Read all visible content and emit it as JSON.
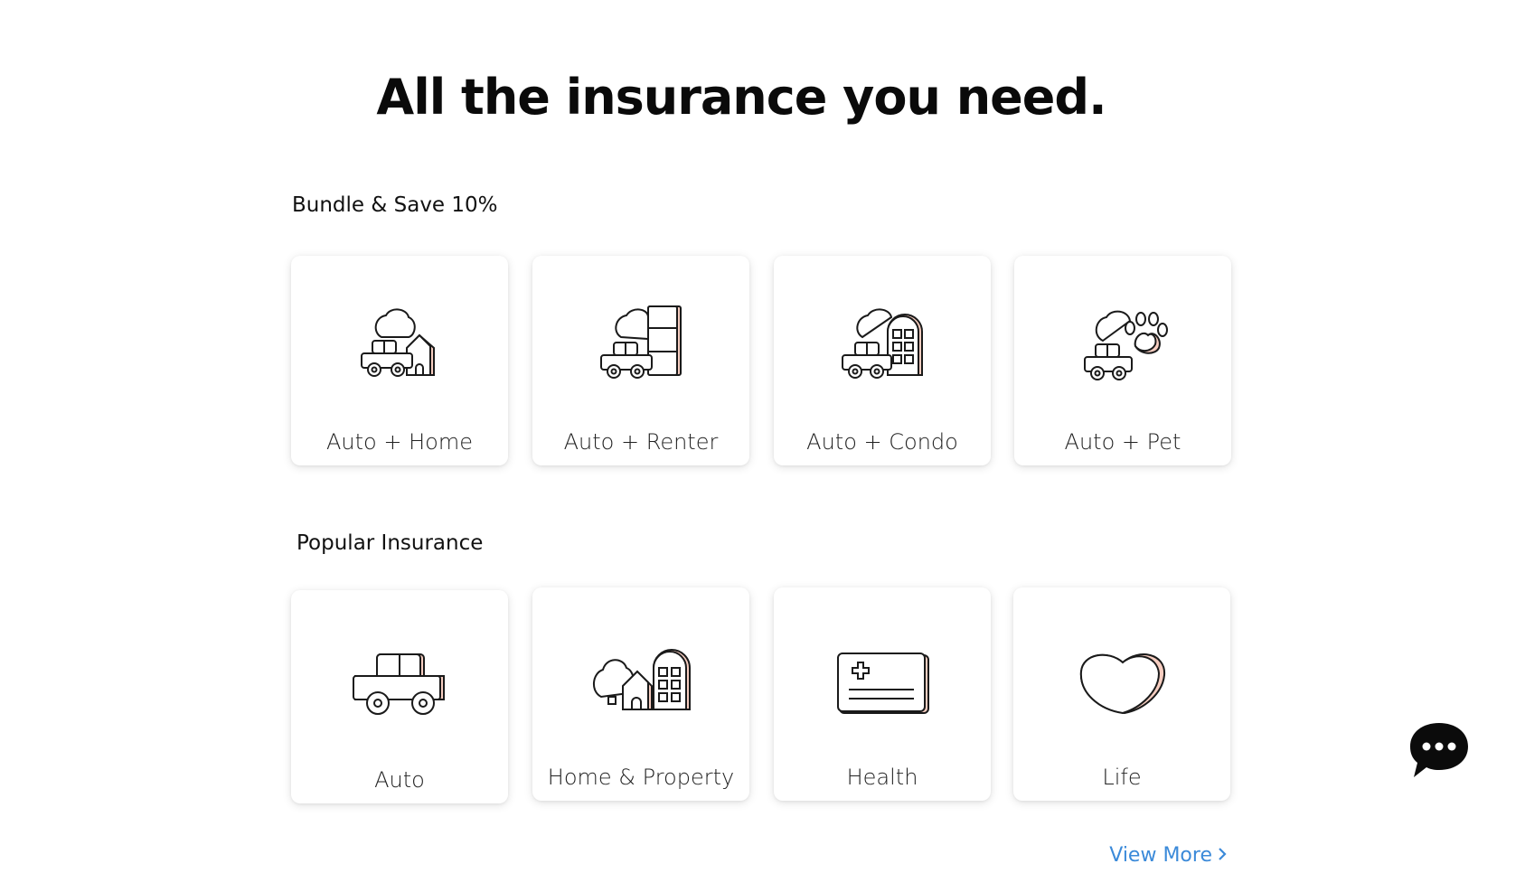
{
  "headline": "All the insurance you need.",
  "bundle": {
    "title": "Bundle & Save 10%",
    "items": [
      {
        "label": "Auto + Home",
        "icon": "auto-home-icon"
      },
      {
        "label": "Auto + Renter",
        "icon": "auto-renter-icon"
      },
      {
        "label": "Auto + Condo",
        "icon": "auto-condo-icon"
      },
      {
        "label": "Auto + Pet",
        "icon": "auto-pet-icon"
      }
    ]
  },
  "popular": {
    "title": "Popular Insurance",
    "items": [
      {
        "label": "Auto",
        "icon": "car-icon"
      },
      {
        "label": "Home & Property",
        "icon": "home-property-icon"
      },
      {
        "label": "Health",
        "icon": "health-card-icon"
      },
      {
        "label": "Life",
        "icon": "heart-icon"
      }
    ]
  },
  "view_more": {
    "label": "View More",
    "icon": "chevron-right-icon"
  },
  "chat": {
    "icon": "chat-bubble-icon"
  },
  "colors": {
    "accent_link": "#3b8ad9",
    "icon_shade": "#f6cdc0",
    "chat_bg": "#0b0b0b"
  }
}
